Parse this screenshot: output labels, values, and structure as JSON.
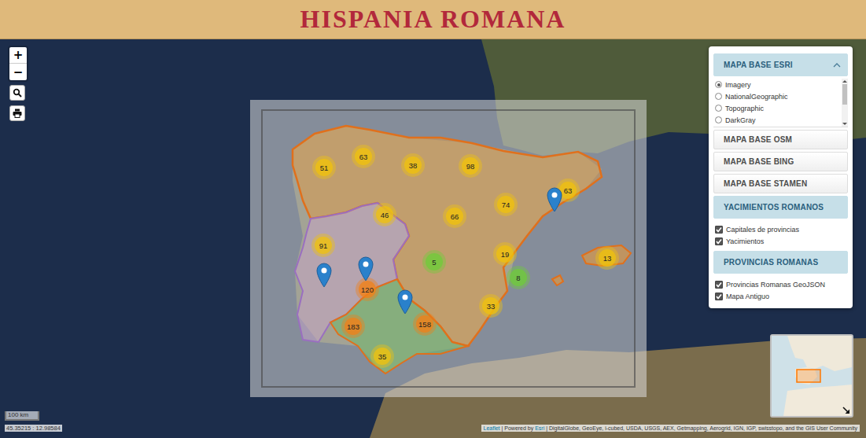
{
  "header": {
    "title": "HISPANIA ROMANA"
  },
  "zoom_controls": [
    {
      "label": "+"
    },
    {
      "label": "−"
    }
  ],
  "layers_panel": {
    "groups": [
      {
        "title": "MAPA BASE ESRI",
        "expanded": true,
        "show_toggle": true,
        "kind": "radio",
        "items": [
          {
            "label": "Imagery",
            "selected": true
          },
          {
            "label": "NationalGeographic",
            "selected": false
          },
          {
            "label": "Topographic",
            "selected": false
          },
          {
            "label": "DarkGray",
            "selected": false
          }
        ]
      },
      {
        "title": "MAPA BASE OSM",
        "expanded": false,
        "show_toggle": false,
        "kind": "radio",
        "items": []
      },
      {
        "title": "MAPA BASE BING",
        "expanded": false,
        "show_toggle": false,
        "kind": "radio",
        "items": []
      },
      {
        "title": "MAPA BASE STAMEN",
        "expanded": false,
        "show_toggle": false,
        "kind": "radio",
        "items": []
      },
      {
        "title": "YACIMIENTOS ROMANOS",
        "expanded": true,
        "show_toggle": false,
        "kind": "checkbox",
        "items": [
          {
            "label": "Capitales de provincias",
            "checked": true
          },
          {
            "label": "Yacimientos",
            "checked": true
          }
        ]
      },
      {
        "title": "PROVINCIAS ROMANAS",
        "expanded": true,
        "show_toggle": false,
        "kind": "checkbox",
        "items": [
          {
            "label": "Provincias Romanas GeoJSON",
            "checked": true
          },
          {
            "label": "Mapa Antiguo",
            "checked": true
          }
        ]
      }
    ]
  },
  "map": {
    "clusters": [
      {
        "count": "51",
        "color": "#f0c20c"
      },
      {
        "count": "63",
        "color": "#f0c20c"
      },
      {
        "count": "38",
        "color": "#f0c20c"
      },
      {
        "count": "98",
        "color": "#f0c20c"
      },
      {
        "count": "63",
        "color": "#f0c20c"
      },
      {
        "count": "46",
        "color": "#f0c20c"
      },
      {
        "count": "66",
        "color": "#f0c20c"
      },
      {
        "count": "74",
        "color": "#f0c20c"
      },
      {
        "count": "91",
        "color": "#f0c20c"
      },
      {
        "count": "5",
        "color": "#6ecc39"
      },
      {
        "count": "19",
        "color": "#f0c20c"
      },
      {
        "count": "8",
        "color": "#6ecc39"
      },
      {
        "count": "13",
        "color": "#f0c20c"
      },
      {
        "count": "120",
        "color": "#f18017"
      },
      {
        "count": "158",
        "color": "#f18017"
      },
      {
        "count": "183",
        "color": "#f18017"
      },
      {
        "count": "33",
        "color": "#f0c20c"
      },
      {
        "count": "35",
        "color": "#f0c20c"
      }
    ],
    "scale": "100 km",
    "coordinates": "45.35215 : 12.98584",
    "attribution": [
      {
        "text": "Leaflet",
        "link": true
      },
      {
        "text": " | Powered by ",
        "link": false
      },
      {
        "text": "Esri",
        "link": true
      },
      {
        "text": " | DigitalGlobe, GeoEye, i-cubed, USDA, USGS, AEX, Getmapping, Aerogrid, IGN, IGP, swisstopo, and the GIS User Community",
        "link": false
      }
    ]
  }
}
